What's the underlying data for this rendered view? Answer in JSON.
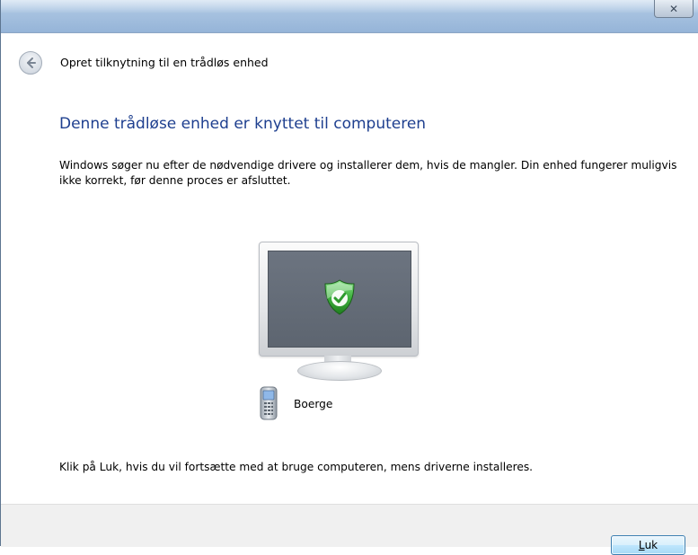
{
  "window": {
    "close_glyph": "✕",
    "title": "Opret tilknytning til en trådløs enhed"
  },
  "content": {
    "heading": "Denne trådløse enhed er knyttet til computeren",
    "description": "Windows søger nu efter de nødvendige drivere og installerer dem, hvis de mangler. Din enhed fungerer muligvis ikke korrekt, før denne proces er afsluttet.",
    "device_name": "Boerge",
    "footer_text": "Klik på Luk, hvis du vil fortsætte med at bruge computeren, mens driverne installeres."
  },
  "buttons": {
    "close_accel": "L",
    "close_rest": "uk"
  },
  "icons": {
    "back": "back-arrow-icon",
    "monitor": "monitor-icon",
    "shield": "security-shield-check-icon",
    "phone": "mobile-phone-icon"
  },
  "colors": {
    "heading": "#1e3f8f",
    "titlebar": "#a7c2e0",
    "shield_green": "#2e9a2e",
    "screen": "#6c7480"
  }
}
